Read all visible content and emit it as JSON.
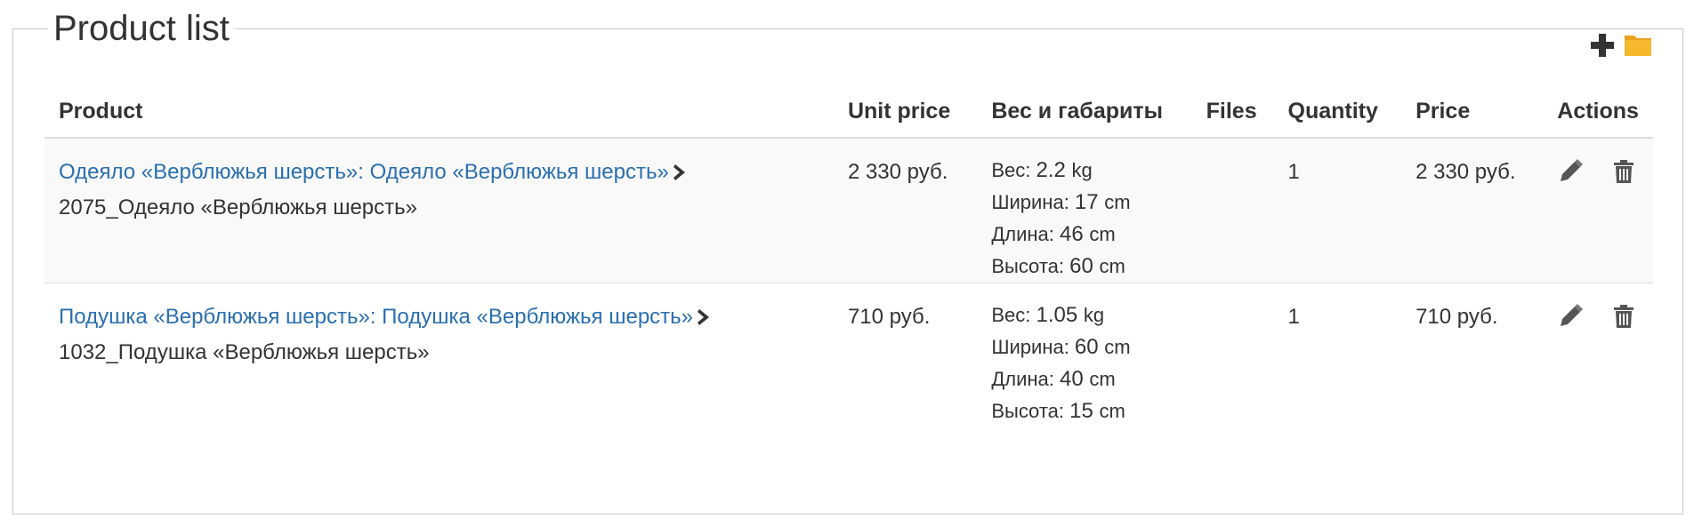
{
  "panel": {
    "title": "Product list"
  },
  "toolbar": {
    "add_icon": "plus-icon",
    "folder_icon": "folder-icon"
  },
  "table": {
    "headers": {
      "product": "Product",
      "unit_price": "Unit price",
      "dims": "Вес и габариты",
      "files": "Files",
      "quantity": "Quantity",
      "price": "Price",
      "actions": "Actions"
    },
    "rows": [
      {
        "product_link": "Одеяло «Верблюжья шерсть»: Одеяло «Верблюжья шерсть»",
        "sku": "2075_Одеяло «Верблюжья шерсть»",
        "unit_price": "2 330 руб.",
        "weight_label": "Вес: ",
        "weight_value": "2.2 ",
        "weight_unit": "kg",
        "width_label": "Ширина: ",
        "width_value": "17 ",
        "width_unit": "cm",
        "length_label": "Длина: ",
        "length_value": "46 ",
        "length_unit": "cm",
        "height_label": "Высота: ",
        "height_value": "60 ",
        "height_unit": "cm",
        "files": "",
        "quantity": "1",
        "price": "2 330 руб."
      },
      {
        "product_link": "Подушка «Верблюжья шерсть»: Подушка «Верблюжья шерсть»",
        "sku": "1032_Подушка «Верблюжья шерсть»",
        "unit_price": "710 руб.",
        "weight_label": "Вес: ",
        "weight_value": "1.05 ",
        "weight_unit": "kg",
        "width_label": "Ширина: ",
        "width_value": "60 ",
        "width_unit": "cm",
        "length_label": "Длина: ",
        "length_value": "40 ",
        "length_unit": "cm",
        "height_label": "Высота: ",
        "height_value": "15 ",
        "height_unit": "cm",
        "files": "",
        "quantity": "1",
        "price": "710 руб."
      }
    ]
  },
  "colors": {
    "link": "#2a6fb0",
    "border": "#dddddd",
    "stripe": "#f9f9f9",
    "folder": "#f5b82e"
  }
}
